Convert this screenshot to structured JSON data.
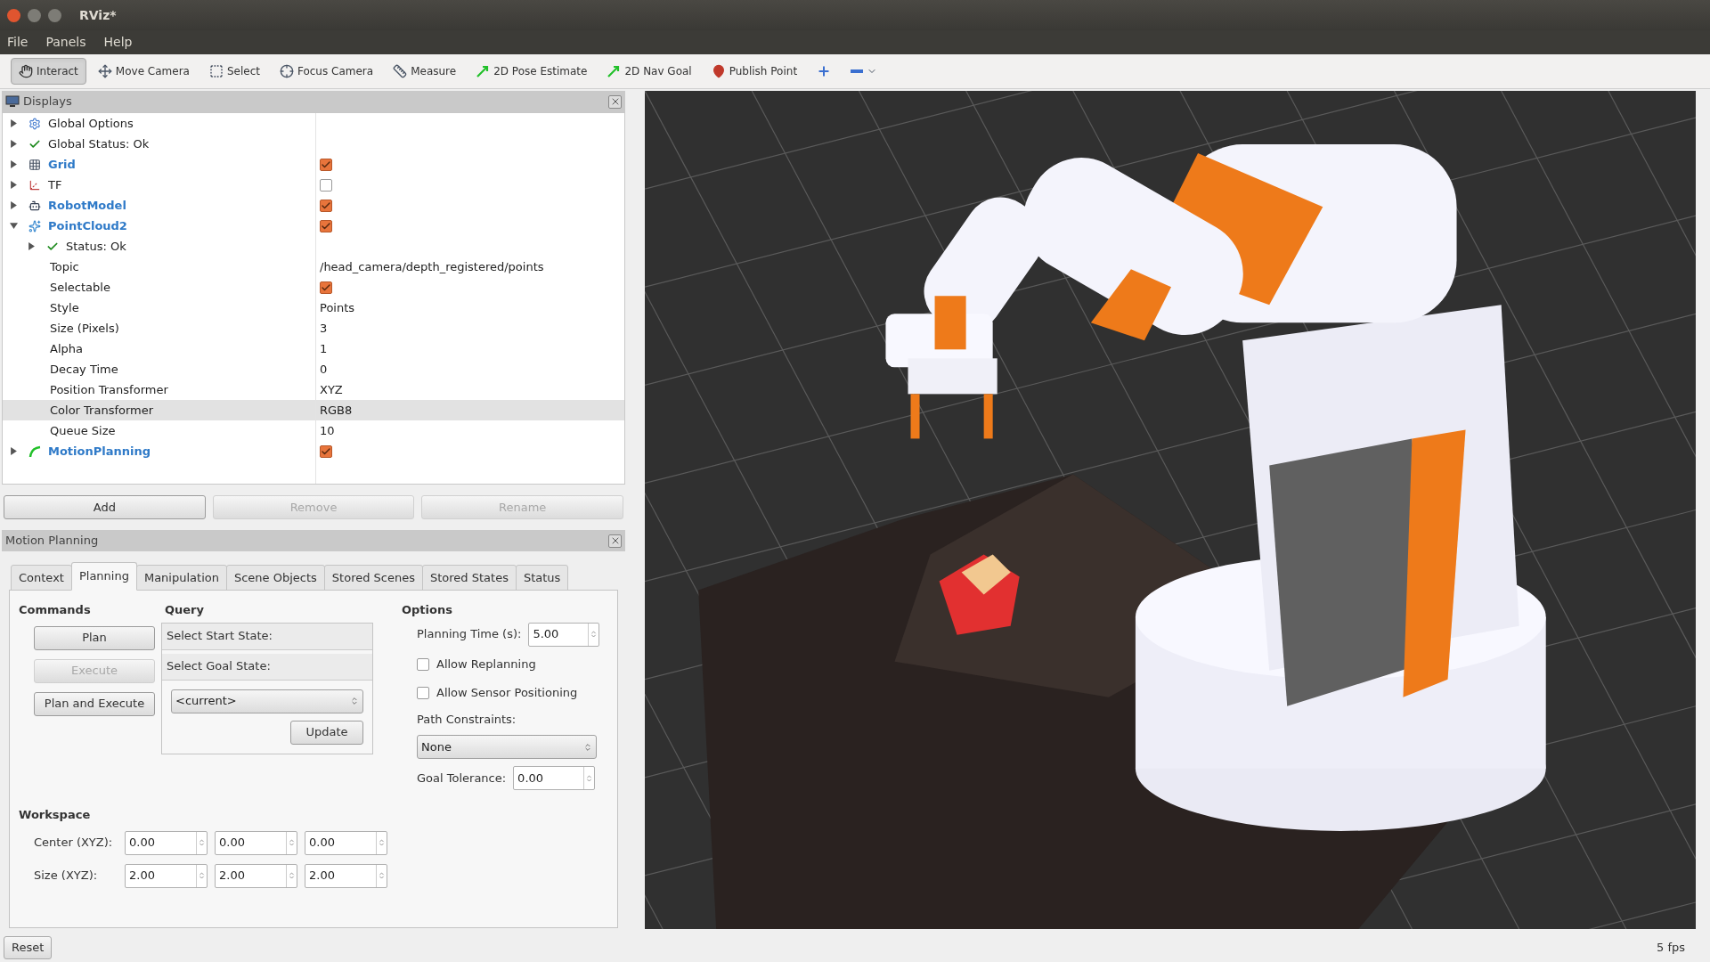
{
  "window": {
    "title": "RViz*"
  },
  "menu": [
    "File",
    "Panels",
    "Help"
  ],
  "toolbar": [
    {
      "kind": "interact",
      "label": "Interact",
      "selected": true
    },
    {
      "kind": "move",
      "label": "Move Camera",
      "selected": false
    },
    {
      "kind": "select",
      "label": "Select",
      "selected": false
    },
    {
      "kind": "focus",
      "label": "Focus Camera",
      "selected": false
    },
    {
      "kind": "measure",
      "label": "Measure",
      "selected": false
    },
    {
      "kind": "pose",
      "label": "2D Pose Estimate",
      "selected": false
    },
    {
      "kind": "goal",
      "label": "2D Nav Goal",
      "selected": false
    },
    {
      "kind": "point",
      "label": "Publish Point",
      "selected": false
    },
    {
      "kind": "add",
      "selected": false
    },
    {
      "kind": "remove",
      "selected": false
    }
  ],
  "displays": {
    "title": "Displays",
    "items": [
      {
        "kind": "options",
        "label": "Global Options",
        "enabled": false,
        "expanded": false,
        "selected": false
      },
      {
        "kind": "status",
        "label": "Global Status: Ok",
        "enabled": false,
        "expanded": false,
        "selected": false
      },
      {
        "kind": "grid",
        "label": "Grid",
        "enabled": true,
        "checked": true,
        "expanded": false,
        "selected": false
      },
      {
        "kind": "tf",
        "label": "TF",
        "enabled": false,
        "checked": false,
        "expanded": false,
        "selected": false
      },
      {
        "kind": "robot",
        "label": "RobotModel",
        "enabled": true,
        "checked": true,
        "expanded": false,
        "selected": false
      },
      {
        "kind": "cloud",
        "label": "PointCloud2",
        "enabled": true,
        "checked": true,
        "expanded": true,
        "selected": false,
        "children": [
          {
            "kind": "status",
            "label": "Status: Ok",
            "enabled": false,
            "expanded": false,
            "selected": false
          },
          {
            "kind": "property",
            "label": "Topic",
            "value": "/head_camera/depth_registered/points",
            "selected": false
          },
          {
            "kind": "property",
            "label": "Selectable",
            "checked": true,
            "selected": false
          },
          {
            "kind": "property",
            "label": "Style",
            "value": "Points",
            "selected": false
          },
          {
            "kind": "property",
            "label": "Size (Pixels)",
            "value": "3",
            "selected": false
          },
          {
            "kind": "property",
            "label": "Alpha",
            "value": "1",
            "selected": false
          },
          {
            "kind": "property",
            "label": "Decay Time",
            "value": "0",
            "selected": false
          },
          {
            "kind": "property",
            "label": "Position Transformer",
            "value": "XYZ",
            "selected": false
          },
          {
            "kind": "property",
            "label": "Color Transformer",
            "value": "RGB8",
            "selected": true
          },
          {
            "kind": "property",
            "label": "Queue Size",
            "value": "10",
            "selected": false
          }
        ]
      },
      {
        "kind": "planning",
        "label": "MotionPlanning",
        "enabled": true,
        "checked": true,
        "expanded": false,
        "selected": false
      }
    ],
    "buttons": [
      {
        "label": "Add",
        "disabled": false
      },
      {
        "label": "Remove",
        "disabled": true
      },
      {
        "label": "Rename",
        "disabled": true
      }
    ]
  },
  "motion_planning": {
    "title": "Motion Planning",
    "tabs": [
      {
        "label": "Context",
        "selected": false
      },
      {
        "label": "Planning",
        "selected": true
      },
      {
        "label": "Manipulation",
        "selected": false
      },
      {
        "label": "Scene Objects",
        "selected": false
      },
      {
        "label": "Stored Scenes",
        "selected": false
      },
      {
        "label": "Stored States",
        "selected": false
      },
      {
        "label": "Status",
        "selected": false
      }
    ],
    "commands": {
      "heading": "Commands",
      "buttons": [
        {
          "label": "Plan",
          "disabled": false
        },
        {
          "label": "Execute",
          "disabled": true
        },
        {
          "label": "Plan and Execute",
          "disabled": false
        }
      ]
    },
    "query": {
      "heading": "Query",
      "start_label": "Select Start State:",
      "goal_label": "Select Goal State:",
      "goal_value": "<current>",
      "update_button": "Update"
    },
    "options": {
      "heading": "Options",
      "planning_time_label": "Planning Time (s):",
      "planning_time": "5.00",
      "checkboxes": [
        {
          "label": "Allow Replanning",
          "checked": false
        },
        {
          "label": "Allow Sensor Positioning",
          "checked": false
        }
      ],
      "path_constraints_label": "Path Constraints:",
      "path_constraints": "None",
      "goal_tolerance_label": "Goal Tolerance:",
      "goal_tolerance": "0.00"
    },
    "workspace": {
      "heading": "Workspace",
      "rows": [
        {
          "label": "Center (XYZ):",
          "values": [
            "0.00",
            "0.00",
            "0.00"
          ]
        },
        {
          "label": "Size (XYZ):",
          "values": [
            "2.00",
            "2.00",
            "2.00"
          ]
        }
      ]
    }
  },
  "status_bar": {
    "reset_button": "Reset",
    "fps": "5 fps"
  }
}
